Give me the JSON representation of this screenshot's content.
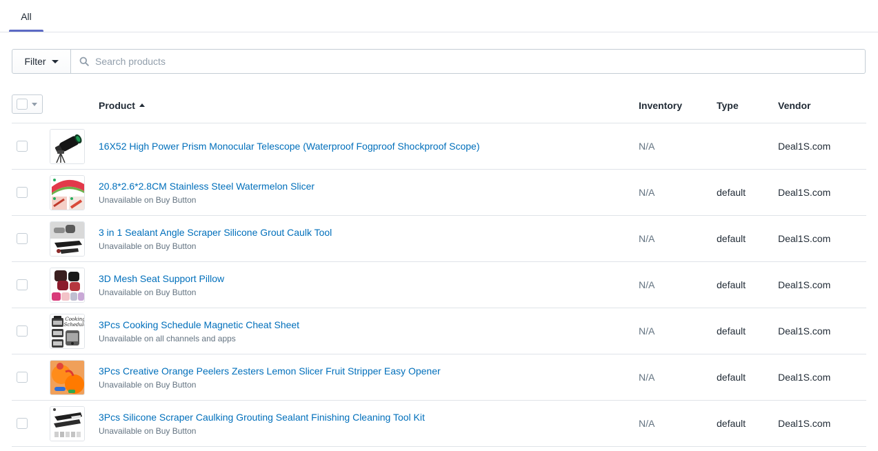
{
  "tabs": {
    "all_label": "All"
  },
  "filter": {
    "label": "Filter"
  },
  "search": {
    "placeholder": "Search products"
  },
  "columns": {
    "product": "Product",
    "inventory": "Inventory",
    "type": "Type",
    "vendor": "Vendor"
  },
  "colors": {
    "link": "#006fbb",
    "accent": "#5c6ac4",
    "border": "#dfe3e8",
    "subdued": "#637381"
  },
  "products": [
    {
      "title": "16X52 High Power Prism Monocular Telescope (Waterproof Fogproof Shockproof Scope)",
      "subtitle": "",
      "inventory": "N/A",
      "type": "",
      "vendor": "Deal1S.com",
      "thumbnail": "monocular-telescope"
    },
    {
      "title": "20.8*2.6*2.8CM Stainless Steel Watermelon Slicer",
      "subtitle": "Unavailable on Buy Button",
      "inventory": "N/A",
      "type": "default",
      "vendor": "Deal1S.com",
      "thumbnail": "watermelon-slicer"
    },
    {
      "title": "3 in 1 Sealant Angle Scraper Silicone Grout Caulk Tool",
      "subtitle": "Unavailable on Buy Button",
      "inventory": "N/A",
      "type": "default",
      "vendor": "Deal1S.com",
      "thumbnail": "caulk-tool"
    },
    {
      "title": "3D Mesh Seat Support Pillow",
      "subtitle": "Unavailable on Buy Button",
      "inventory": "N/A",
      "type": "default",
      "vendor": "Deal1S.com",
      "thumbnail": "seat-pillows"
    },
    {
      "title": "3Pcs Cooking Schedule Magnetic Cheat Sheet",
      "subtitle": "Unavailable on all channels and apps",
      "inventory": "N/A",
      "type": "default",
      "vendor": "Deal1S.com",
      "thumbnail": "cooking-schedule",
      "thumbnail_text": [
        "Cooking",
        "Schedule"
      ]
    },
    {
      "title": "3Pcs Creative Orange Peelers Zesters Lemon Slicer Fruit Stripper Easy Opener",
      "subtitle": "Unavailable on Buy Button",
      "inventory": "N/A",
      "type": "default",
      "vendor": "Deal1S.com",
      "thumbnail": "orange-peeler"
    },
    {
      "title": "3Pcs Silicone Scraper Caulking Grouting Sealant Finishing Cleaning Tool Kit",
      "subtitle": "Unavailable on Buy Button",
      "inventory": "N/A",
      "type": "default",
      "vendor": "Deal1S.com",
      "thumbnail": "scraper-kit"
    }
  ]
}
